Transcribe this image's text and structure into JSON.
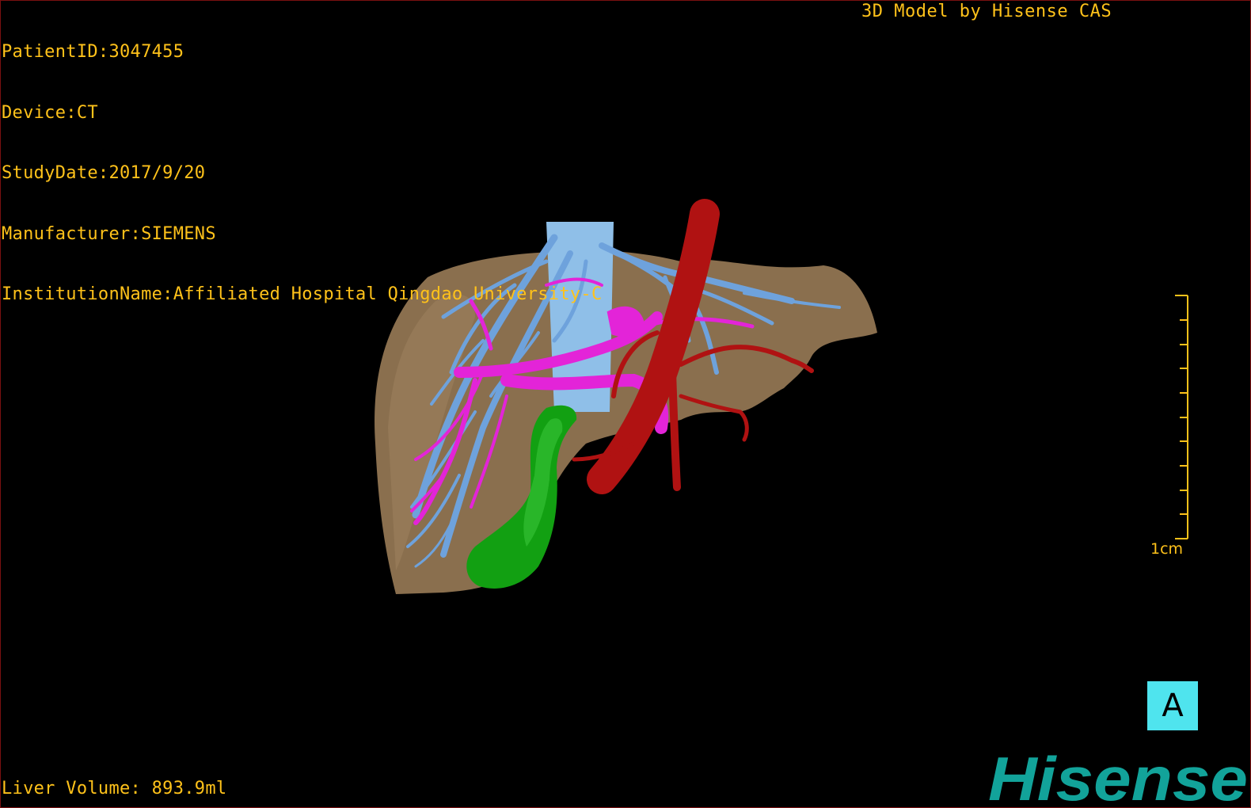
{
  "overlay": {
    "patient_id": "PatientID:3047455",
    "device": "Device:CT",
    "study_date": "StudyDate:2017/9/20",
    "manufacturer": "Manufacturer:SIEMENS",
    "institution": "InstitutionName:Affiliated Hospital Qingdao University-C",
    "credit": "3D Model by Hisense CAS",
    "liver_volume": "Liver Volume: 893.9ml"
  },
  "scale_bar": {
    "label": "1cm"
  },
  "view_badge": {
    "label": "A"
  },
  "logo": {
    "text": "Hisense",
    "color": "#12a39a"
  },
  "colors": {
    "overlay_text": "#ffc21a",
    "liver": "#8a6f4e",
    "hepatic_vein": "#6ea2dc",
    "portal_vein": "#e324d8",
    "artery": "#b01212",
    "gallbladder": "#12a012",
    "badge": "#4fe4ee"
  }
}
